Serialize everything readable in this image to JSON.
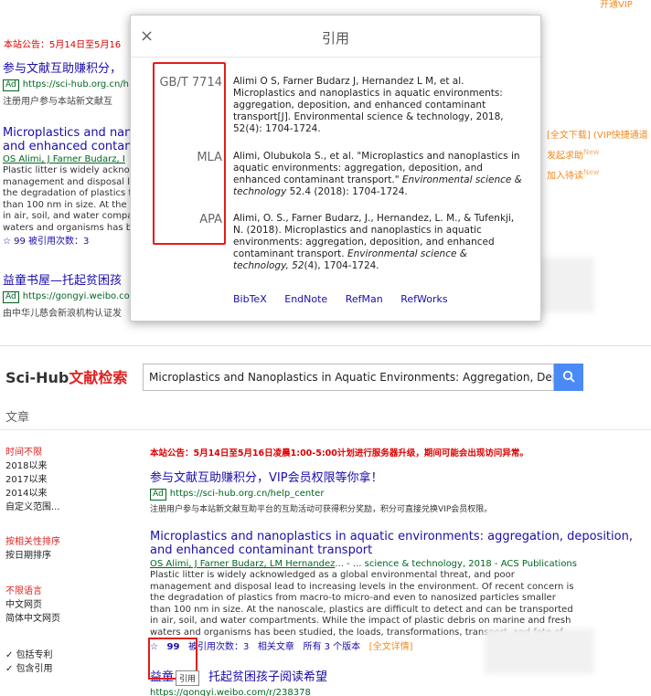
{
  "top": {
    "notice": "本站公告：5月14日至5月16",
    "vip_corner": "开通VIP",
    "bg_results": [
      {
        "title": "参与文献互助赚积分，",
        "ad": "Ad",
        "url": "https://sci-hub.org.cn/h",
        "desc": "注册用户参与本站新文献互"
      },
      {
        "title1": "Microplastics and nano",
        "title2": "and enhanced contamin",
        "authors": "OS Alimi, J Farner Budarz, I",
        "snippet": [
          "Plastic litter is widely ackno",
          "management and disposal le",
          "the degradation of plastics fr",
          "than 100 nm in size. At the",
          "in air, soil, and water compa",
          "waters and organisms has b"
        ],
        "actions": "☆  99  被引用次数：3"
      },
      {
        "title": "益童书屋—托起贫困孩",
        "ad": "Ad",
        "url": "https://gongyi.weibo.co",
        "desc": "由中华儿慈会新浪机构认证发"
      }
    ],
    "right_links": {
      "full_text": "[全文下载]",
      "vip_fast": "(VIP快捷通道",
      "seek": "发起求助",
      "seek_new": "New",
      "queue": "加入待读",
      "queue_new": "New"
    }
  },
  "modal": {
    "close": "×",
    "title": "引用",
    "gbt_label": "GB/T 7714",
    "gbt_text": "Alimi O S, Farner Budarz J, Hernandez L M, et al. Microplastics and nanoplastics in aquatic environments: aggregation, deposition, and enhanced contaminant transport[J]. Environmental science & technology, 2018, 52(4): 1704-1724.",
    "mla_label": "MLA",
    "mla_text_a": "Alimi, Olubukola S., et al. \"Microplastics and nanoplastics in aquatic environments: aggregation, deposition, and enhanced contaminant transport.\" ",
    "mla_text_i": "Environmental science & technology",
    "mla_text_b": " 52.4 (2018): 1704-1724.",
    "apa_label": "APA",
    "apa_text_a": "Alimi, O. S., Farner Budarz, J., Hernandez, L. M., & Tufenkji, N. (2018). Microplastics and nanoplastics in aquatic environments: aggregation, deposition, and enhanced contaminant transport. ",
    "apa_text_i": "Environmental science & technology, 52",
    "apa_text_b": "(4), 1704-1724.",
    "formats": [
      "BibTeX",
      "EndNote",
      "RefMan",
      "RefWorks"
    ]
  },
  "bottom": {
    "logo_a": "Sci-Hub",
    "logo_b": "文献检索",
    "search_value": "Microplastics and Nanoplastics in Aquatic Environments: Aggregation, Deposit",
    "category": "文章",
    "sidebar": {
      "time_any": "时间不限",
      "times": [
        "2018以来",
        "2017以来",
        "2014以来",
        "自定义范围..."
      ],
      "sort_rel": "按相关性排序",
      "sort_date": "按日期排序",
      "lang_any": "不限语言",
      "langs": [
        "中文网页",
        "简体中文网页"
      ],
      "checks": [
        "包括专利",
        "包含引用"
      ]
    },
    "notice": "本站公告：5月14日至5月16日凌晨1:00-5:00计划进行服务器升级，期间可能会出现访问异常。",
    "ad1": {
      "title": "参与文献互助赚积分，VIP会员权限等你拿！",
      "ad": "Ad",
      "url": "https://sci-hub.org.cn/help_center",
      "desc": "注册用户参与本站新文献互助平台的互助活动可获得积分奖励，积分可直接兑换VIP会员权限。"
    },
    "result": {
      "title1": "Microplastics and nanoplastics in aquatic environments: aggregation, deposition,",
      "title2": "and enhanced contaminant transport",
      "authors": "OS Alimi, J Farner Budarz, LM Hernandez",
      "meta": "... - ... science & technology, 2018 - ACS Publications",
      "snippet": [
        "Plastic litter is widely acknowledged as a global environmental threat, and poor",
        "management and disposal lead to increasing levels in the environment. Of recent concern is",
        "the degradation of plastics from macro-to micro-and even to nanosized particles smaller",
        "than 100 nm in size. At the nanoscale, plastics are difficult to detect and can be transported",
        "in air, soil, and water compartments. While the impact of plastic debris on marine and fresh",
        "waters and organisms has been studied, the loads, transformations, transport, and fate of ..."
      ],
      "star": "☆",
      "cite": "99",
      "cited_by": "被引用次数：3",
      "related": "相关文章",
      "versions": "所有 3 个版本",
      "full": "[全文详情]"
    },
    "tooltip": "引用",
    "ad2_title_a": "益童",
    "ad2_title_b": "托起贫困孩子阅读希望",
    "ad2_url": "https://gongyi.weibo.com/r/238378"
  }
}
